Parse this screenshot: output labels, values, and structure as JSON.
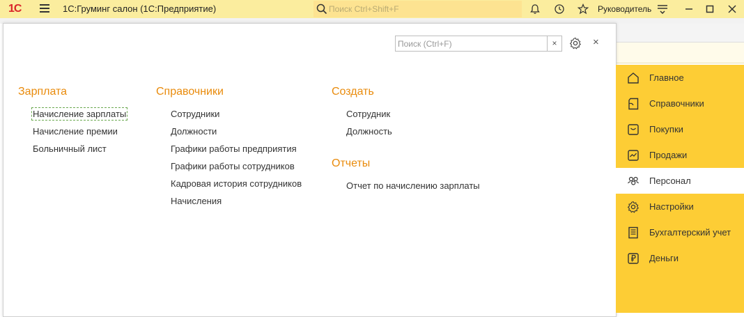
{
  "titlebar": {
    "logo": "1С",
    "title": "1С:Груминг салон  (1С:Предприятие)",
    "search_placeholder": "Поиск Ctrl+Shift+F",
    "user": "Руководитель"
  },
  "panel": {
    "search_placeholder": "Поиск (Ctrl+F)",
    "clear": "×",
    "close": "×",
    "sections": {
      "salary": {
        "title": "Зарплата",
        "items": [
          "Начисление зарплаты",
          "Начисление премии",
          "Больничный лист"
        ]
      },
      "refs": {
        "title": "Справочники",
        "items": [
          "Сотрудники",
          "Должности",
          "Графики работы предприятия",
          "Графики работы сотрудников",
          "Кадровая история сотрудников",
          "Начисления"
        ]
      },
      "create": {
        "title": "Создать",
        "items": [
          "Сотрудник",
          "Должность"
        ]
      },
      "reports": {
        "title": "Отчеты",
        "items": [
          "Отчет по начислению зарплаты"
        ]
      }
    }
  },
  "nav": {
    "items": [
      {
        "label": "Главное",
        "icon": "home-icon"
      },
      {
        "label": "Справочники",
        "icon": "book-icon"
      },
      {
        "label": "Покупки",
        "icon": "cart-icon"
      },
      {
        "label": "Продажи",
        "icon": "chart-icon"
      },
      {
        "label": "Персонал",
        "icon": "people-icon",
        "active": true
      },
      {
        "label": "Настройки",
        "icon": "gear-icon"
      },
      {
        "label": "Бухгалтерский учет",
        "icon": "ledger-icon"
      },
      {
        "label": "Деньги",
        "icon": "ruble-icon"
      }
    ]
  },
  "colors": {
    "titlebar": "#fbed9e",
    "nav": "#fdcd35",
    "section": "#e98b0c",
    "logo": "#d9252a"
  }
}
